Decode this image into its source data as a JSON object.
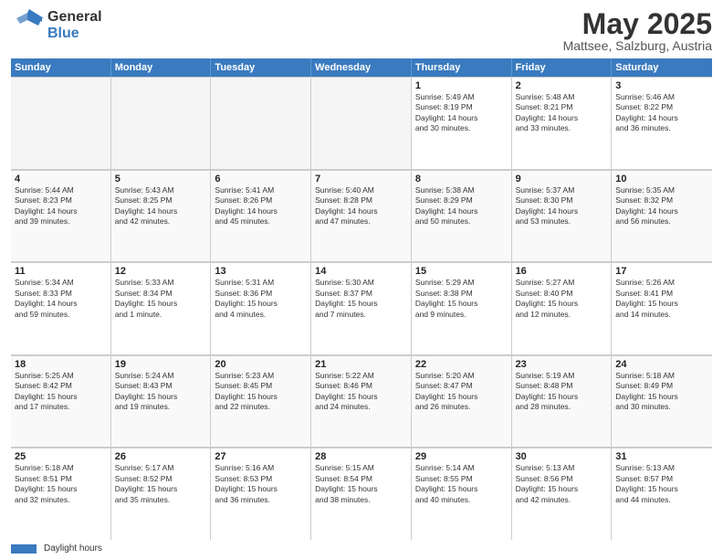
{
  "logo": {
    "general": "General",
    "blue": "Blue"
  },
  "header": {
    "month": "May 2025",
    "location": "Mattsee, Salzburg, Austria"
  },
  "weekdays": [
    "Sunday",
    "Monday",
    "Tuesday",
    "Wednesday",
    "Thursday",
    "Friday",
    "Saturday"
  ],
  "rows": [
    [
      {
        "day": "",
        "info": "",
        "empty": true
      },
      {
        "day": "",
        "info": "",
        "empty": true
      },
      {
        "day": "",
        "info": "",
        "empty": true
      },
      {
        "day": "",
        "info": "",
        "empty": true
      },
      {
        "day": "1",
        "info": "Sunrise: 5:49 AM\nSunset: 8:19 PM\nDaylight: 14 hours\nand 30 minutes."
      },
      {
        "day": "2",
        "info": "Sunrise: 5:48 AM\nSunset: 8:21 PM\nDaylight: 14 hours\nand 33 minutes."
      },
      {
        "day": "3",
        "info": "Sunrise: 5:46 AM\nSunset: 8:22 PM\nDaylight: 14 hours\nand 36 minutes."
      }
    ],
    [
      {
        "day": "4",
        "info": "Sunrise: 5:44 AM\nSunset: 8:23 PM\nDaylight: 14 hours\nand 39 minutes."
      },
      {
        "day": "5",
        "info": "Sunrise: 5:43 AM\nSunset: 8:25 PM\nDaylight: 14 hours\nand 42 minutes."
      },
      {
        "day": "6",
        "info": "Sunrise: 5:41 AM\nSunset: 8:26 PM\nDaylight: 14 hours\nand 45 minutes."
      },
      {
        "day": "7",
        "info": "Sunrise: 5:40 AM\nSunset: 8:28 PM\nDaylight: 14 hours\nand 47 minutes."
      },
      {
        "day": "8",
        "info": "Sunrise: 5:38 AM\nSunset: 8:29 PM\nDaylight: 14 hours\nand 50 minutes."
      },
      {
        "day": "9",
        "info": "Sunrise: 5:37 AM\nSunset: 8:30 PM\nDaylight: 14 hours\nand 53 minutes."
      },
      {
        "day": "10",
        "info": "Sunrise: 5:35 AM\nSunset: 8:32 PM\nDaylight: 14 hours\nand 56 minutes."
      }
    ],
    [
      {
        "day": "11",
        "info": "Sunrise: 5:34 AM\nSunset: 8:33 PM\nDaylight: 14 hours\nand 59 minutes."
      },
      {
        "day": "12",
        "info": "Sunrise: 5:33 AM\nSunset: 8:34 PM\nDaylight: 15 hours\nand 1 minute."
      },
      {
        "day": "13",
        "info": "Sunrise: 5:31 AM\nSunset: 8:36 PM\nDaylight: 15 hours\nand 4 minutes."
      },
      {
        "day": "14",
        "info": "Sunrise: 5:30 AM\nSunset: 8:37 PM\nDaylight: 15 hours\nand 7 minutes."
      },
      {
        "day": "15",
        "info": "Sunrise: 5:29 AM\nSunset: 8:38 PM\nDaylight: 15 hours\nand 9 minutes."
      },
      {
        "day": "16",
        "info": "Sunrise: 5:27 AM\nSunset: 8:40 PM\nDaylight: 15 hours\nand 12 minutes."
      },
      {
        "day": "17",
        "info": "Sunrise: 5:26 AM\nSunset: 8:41 PM\nDaylight: 15 hours\nand 14 minutes."
      }
    ],
    [
      {
        "day": "18",
        "info": "Sunrise: 5:25 AM\nSunset: 8:42 PM\nDaylight: 15 hours\nand 17 minutes."
      },
      {
        "day": "19",
        "info": "Sunrise: 5:24 AM\nSunset: 8:43 PM\nDaylight: 15 hours\nand 19 minutes."
      },
      {
        "day": "20",
        "info": "Sunrise: 5:23 AM\nSunset: 8:45 PM\nDaylight: 15 hours\nand 22 minutes."
      },
      {
        "day": "21",
        "info": "Sunrise: 5:22 AM\nSunset: 8:46 PM\nDaylight: 15 hours\nand 24 minutes."
      },
      {
        "day": "22",
        "info": "Sunrise: 5:20 AM\nSunset: 8:47 PM\nDaylight: 15 hours\nand 26 minutes."
      },
      {
        "day": "23",
        "info": "Sunrise: 5:19 AM\nSunset: 8:48 PM\nDaylight: 15 hours\nand 28 minutes."
      },
      {
        "day": "24",
        "info": "Sunrise: 5:18 AM\nSunset: 8:49 PM\nDaylight: 15 hours\nand 30 minutes."
      }
    ],
    [
      {
        "day": "25",
        "info": "Sunrise: 5:18 AM\nSunset: 8:51 PM\nDaylight: 15 hours\nand 32 minutes."
      },
      {
        "day": "26",
        "info": "Sunrise: 5:17 AM\nSunset: 8:52 PM\nDaylight: 15 hours\nand 35 minutes."
      },
      {
        "day": "27",
        "info": "Sunrise: 5:16 AM\nSunset: 8:53 PM\nDaylight: 15 hours\nand 36 minutes."
      },
      {
        "day": "28",
        "info": "Sunrise: 5:15 AM\nSunset: 8:54 PM\nDaylight: 15 hours\nand 38 minutes."
      },
      {
        "day": "29",
        "info": "Sunrise: 5:14 AM\nSunset: 8:55 PM\nDaylight: 15 hours\nand 40 minutes."
      },
      {
        "day": "30",
        "info": "Sunrise: 5:13 AM\nSunset: 8:56 PM\nDaylight: 15 hours\nand 42 minutes."
      },
      {
        "day": "31",
        "info": "Sunrise: 5:13 AM\nSunset: 8:57 PM\nDaylight: 15 hours\nand 44 minutes."
      }
    ]
  ],
  "footer": {
    "legend_label": "Daylight hours"
  }
}
